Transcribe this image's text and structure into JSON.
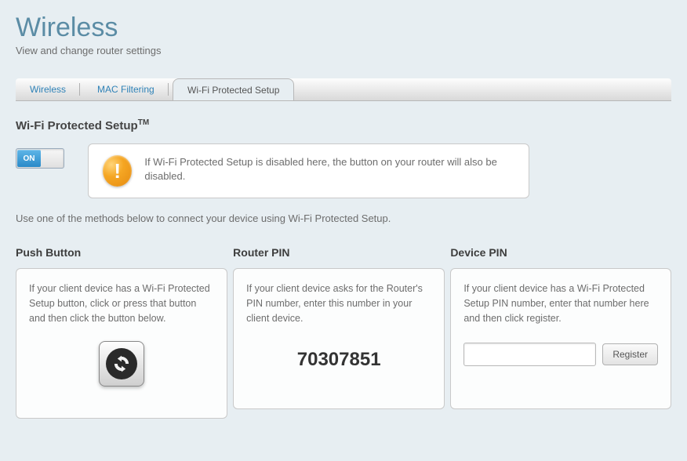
{
  "header": {
    "title": "Wireless",
    "subtitle": "View and change router settings"
  },
  "tabs": {
    "wireless": "Wireless",
    "mac": "MAC Filtering",
    "wps": "Wi-Fi Protected Setup"
  },
  "section": {
    "title": "Wi-Fi Protected Setup",
    "tm": "TM"
  },
  "toggle": {
    "on_label": "ON"
  },
  "warning": "If Wi-Fi Protected Setup is disabled here, the button on your router will also be disabled.",
  "instruction": "Use one of the methods below to connect your device using Wi-Fi Protected Setup.",
  "push": {
    "title": "Push Button",
    "text": "If your client device has a Wi-Fi Protected Setup button, click or press that button and then click the button below."
  },
  "router_pin": {
    "title": "Router PIN",
    "text": "If your client device asks for the Router's PIN number, enter this number in your client device.",
    "value": "70307851"
  },
  "device_pin": {
    "title": "Device PIN",
    "text": "If your client device has a Wi-Fi Protected Setup PIN number, enter that number here and then click register.",
    "input_value": "",
    "register": "Register"
  }
}
